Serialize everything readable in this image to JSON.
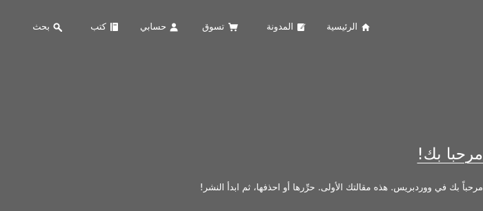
{
  "nav": {
    "items": [
      {
        "label": "الرئيسية",
        "icon": "home-icon"
      },
      {
        "label": "المدونة",
        "icon": "edit-icon"
      },
      {
        "label": "تسوق",
        "icon": "cart-icon"
      },
      {
        "label": "حسابي",
        "icon": "user-icon"
      },
      {
        "label": "كتب",
        "icon": "book-icon"
      },
      {
        "label": "بحث",
        "icon": "search-icon"
      }
    ]
  },
  "post": {
    "title": "مرحبا بك!",
    "excerpt": "مرحباً بك في ووردبريس. هذه مقالتك الأولى. حرِّرها أو احذفها، ثم ابدأ النشر!"
  },
  "colors": {
    "background": "#626262",
    "text": "#ffffff"
  }
}
